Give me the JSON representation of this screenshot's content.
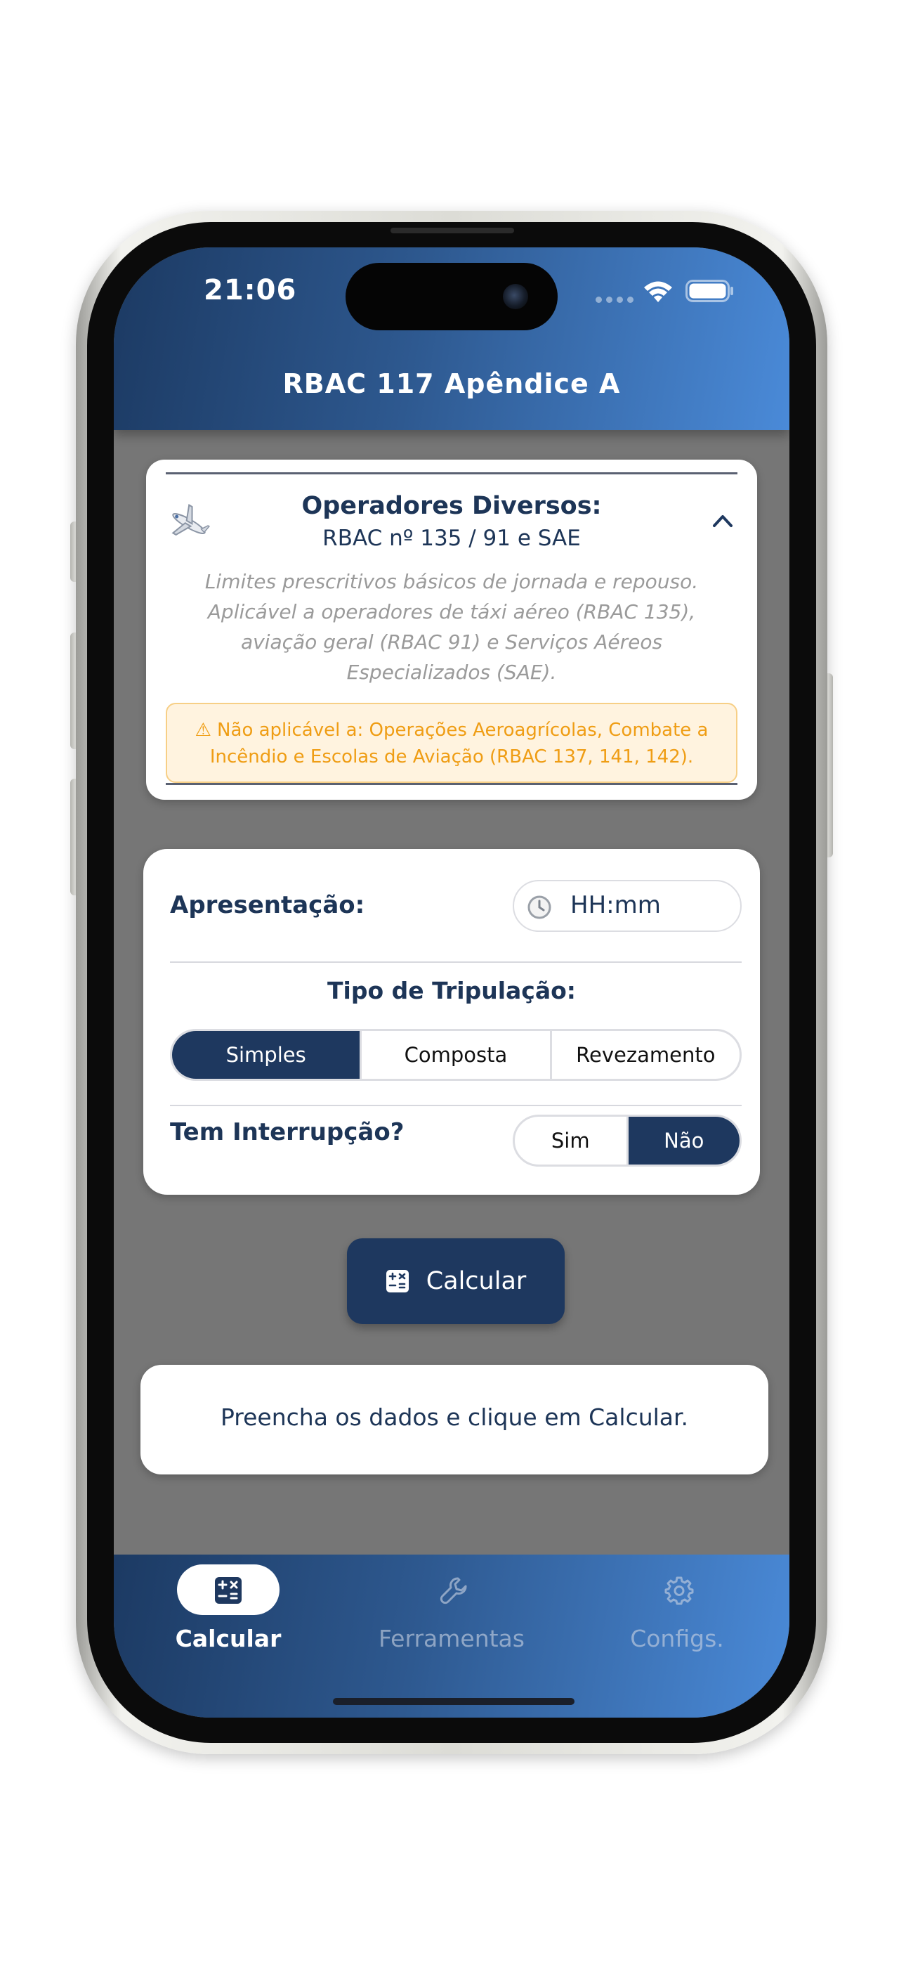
{
  "status_bar": {
    "time": "21:06"
  },
  "header": {
    "title": "RBAC 117 Apêndice A"
  },
  "info_card": {
    "heading": "Operadores Diversos:",
    "subheading": "RBAC nº 135 / 91 e SAE",
    "description": "Limites prescritivos básicos de jornada e repouso. Aplicável a operadores de táxi aéreo (RBAC 135), aviação geral (RBAC 91) e Serviços Aéreos Especializados (SAE).",
    "warning": "⚠ Não aplicável a: Operações Aeroagrícolas, Combate a Incêndio e Escolas de Aviação (RBAC 137, 141, 142)."
  },
  "form": {
    "apresentacao_label": "Apresentação:",
    "time_placeholder": "HH:mm",
    "tipo_label": "Tipo de Tripulação:",
    "tripulacao_options": [
      "Simples",
      "Composta",
      "Revezamento"
    ],
    "tripulacao_selected": "Simples",
    "interrupcao_label": "Tem Interrupção?",
    "interrupcao_options": [
      "Sim",
      "Não"
    ],
    "interrupcao_selected": "Não"
  },
  "calc_button": {
    "label": "Calcular"
  },
  "result": {
    "message": "Preencha os dados e clique em Calcular."
  },
  "bottom_nav": {
    "items": [
      {
        "label": "Calcular",
        "icon": "calculator-icon",
        "active": true
      },
      {
        "label": "Ferramentas",
        "icon": "wrench-icon",
        "active": false
      },
      {
        "label": "Configs.",
        "icon": "gear-icon",
        "active": false
      }
    ]
  },
  "colors": {
    "primary": "#1e385f",
    "header_gradient_start": "#1c3a63",
    "header_gradient_end": "#4a8ad8",
    "text": "#1d3557",
    "warning_text": "#ef9d14",
    "warning_bg": "#fff3df",
    "screen_bg": "#767676"
  }
}
